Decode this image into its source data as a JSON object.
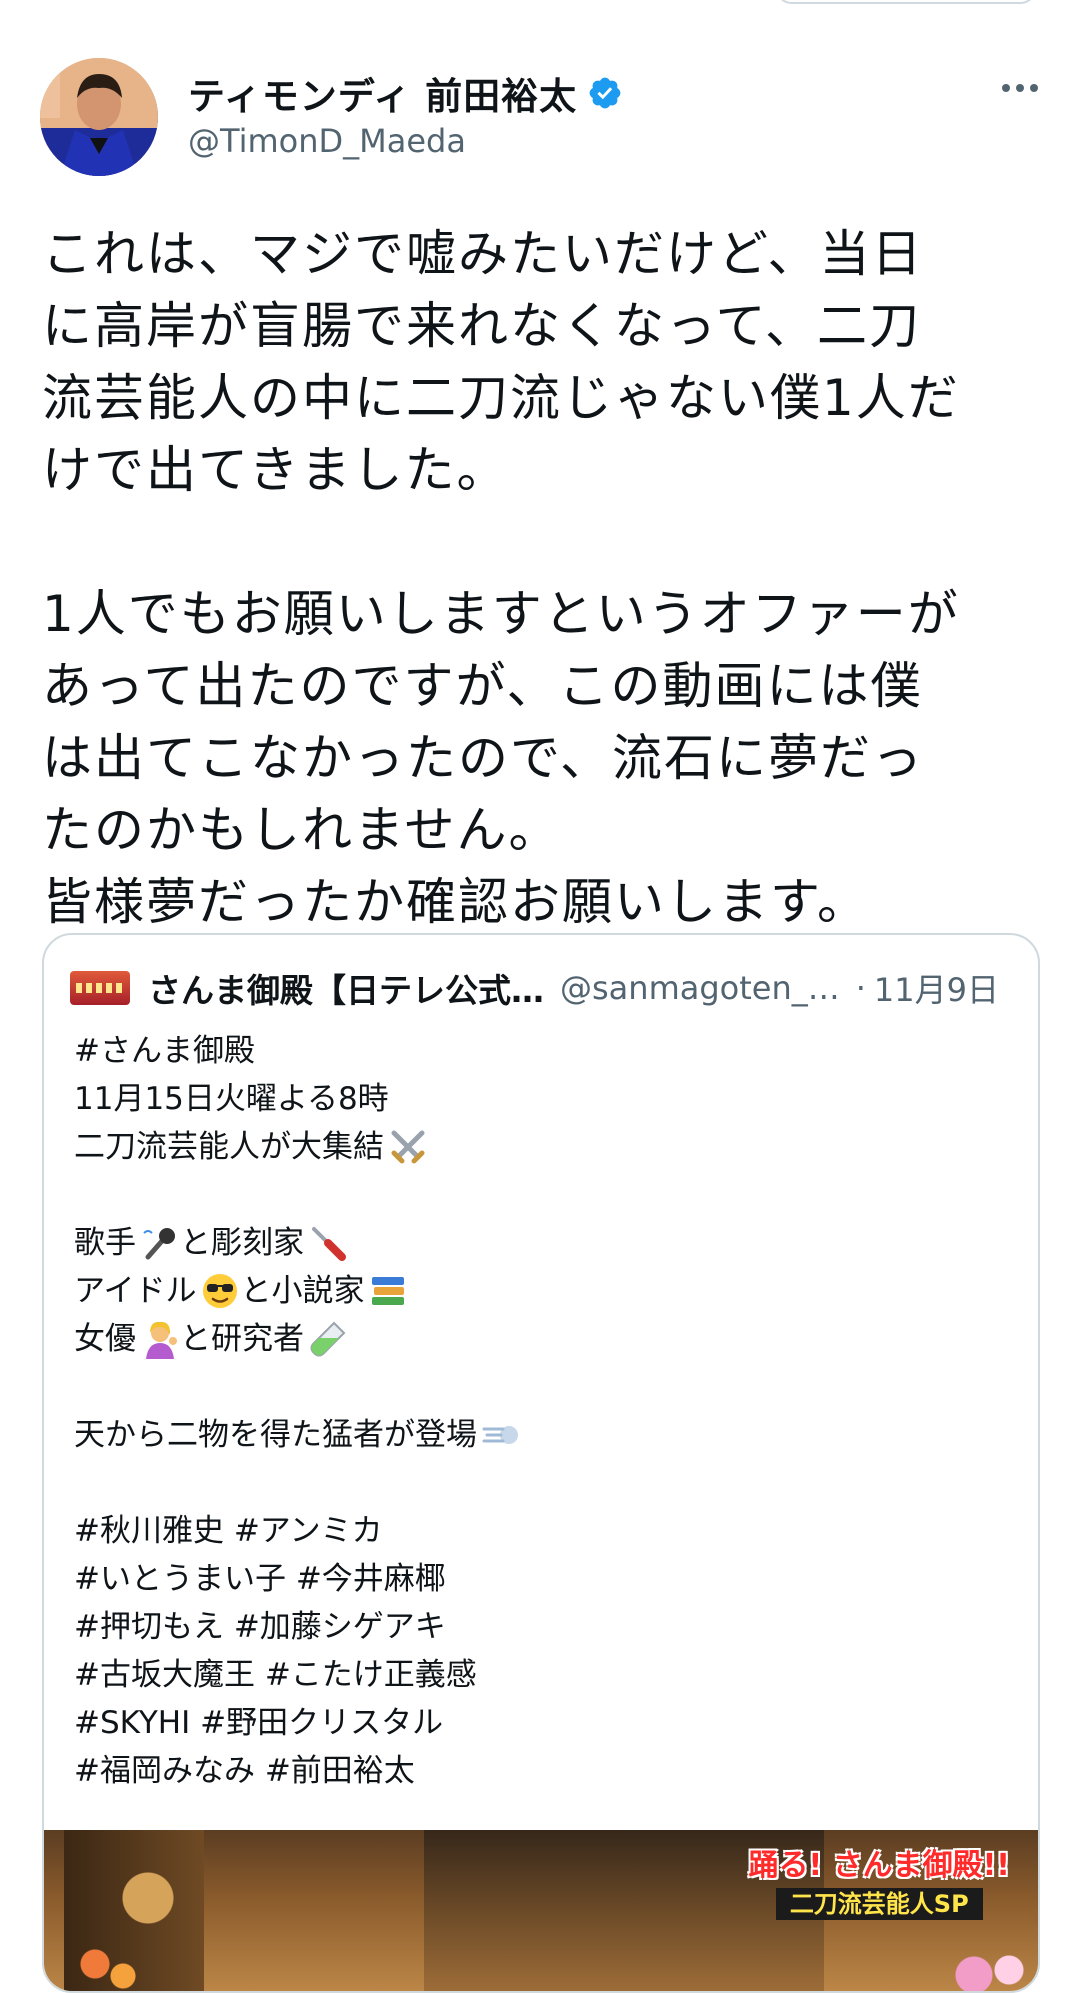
{
  "author": {
    "display_name": "ティモンディ 前田裕太",
    "handle": "@TimonD_Maeda",
    "verified": true
  },
  "tweet": {
    "text": "これは、マジで嘘みたいだけど、当日\nに高岸が盲腸で来れなくなって、二刀\n流芸能人の中に二刀流じゃない僕1人だ\nけで出てきました。\n\n1人でもお願いしますというオファーが\nあって出たのですが、この動画には僕\nは出てこなかったので、流石に夢だっ\nたのかもしれません。\n皆様夢だったか確認お願いします。"
  },
  "quote": {
    "name": "さんま御殿【日テレ公式…",
    "handle": "@sanmagoten_…",
    "separator": "·",
    "date": "11月9日",
    "lines": {
      "l1": "#さんま御殿",
      "l2": "11月15日火曜よる8時",
      "l3": "二刀流芸能人が大集結",
      "l4a": "歌手",
      "l4b": "と彫刻家",
      "l5a": "アイドル",
      "l5b": "と小説家",
      "l6a": "女優",
      "l6b": "と研究者",
      "l7": "天から二物を得た猛者が登場",
      "l8": "#秋川雅史 #アンミカ",
      "l9": "#いとうまい子 #今井麻椰",
      "l10": "#押切もえ #加藤シゲアキ",
      "l11": "#古坂大魔王 #こたけ正義感",
      "l12": "#SKYHI #野田クリスタル",
      "l13": "#福岡みなみ #前田裕太"
    },
    "emoji_icons": [
      "crossed-swords-icon",
      "microphone-icon",
      "screwdriver-icon",
      "sunglasses-face-icon",
      "books-icon",
      "woman-tipping-hand-icon",
      "test-tube-icon",
      "dash-icon"
    ],
    "media": {
      "title": "踊る! さんま御殿!!",
      "subtitle": "二刀流芸能人SP"
    }
  },
  "colors": {
    "text": "#0f1419",
    "secondary": "#536471",
    "verified": "#1d9bf0",
    "border": "#cfd9de"
  }
}
